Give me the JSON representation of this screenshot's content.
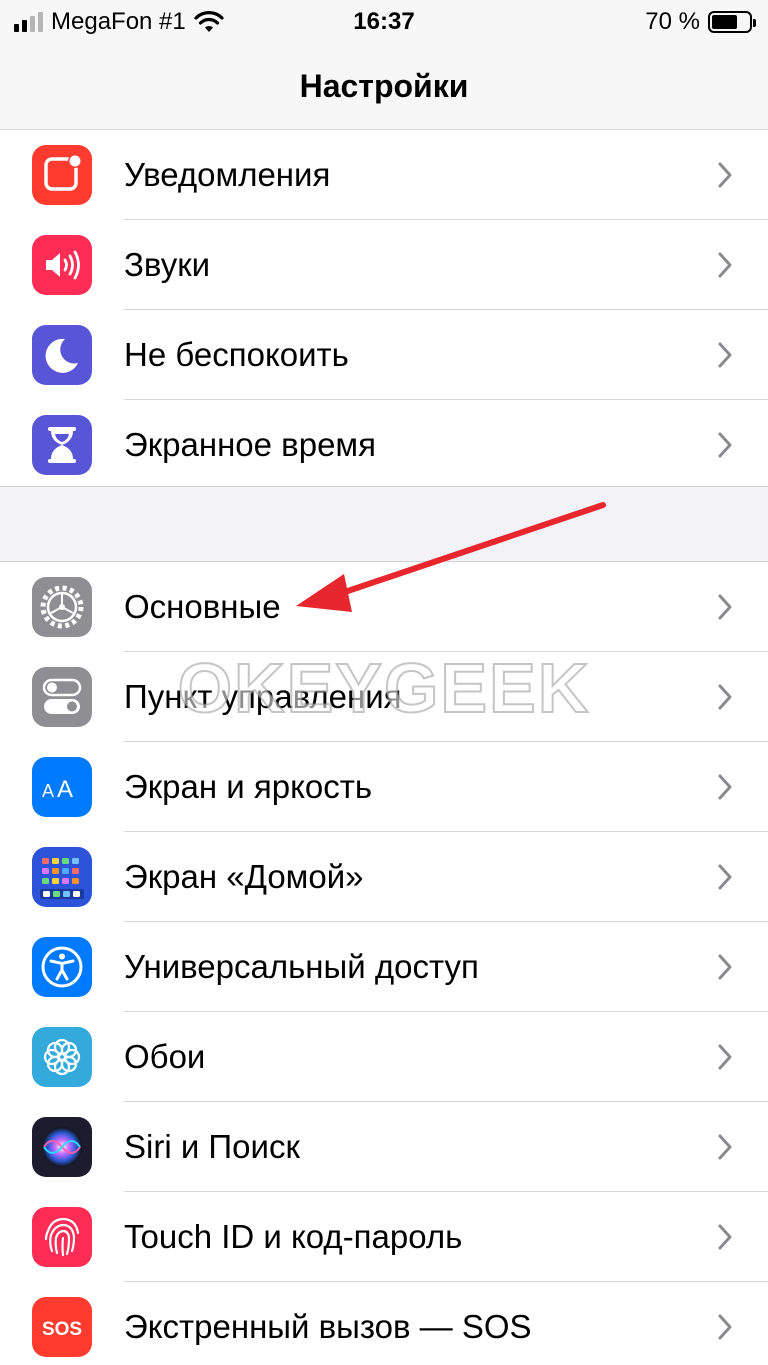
{
  "status_bar": {
    "carrier": "MegaFon #1",
    "time": "16:37",
    "battery_text": "70 %",
    "battery_level": 0.7
  },
  "nav": {
    "title": "Настройки"
  },
  "group1": [
    {
      "key": "notifications",
      "label": "Уведомления",
      "icon": "notifications-icon",
      "color": "#ff3b30"
    },
    {
      "key": "sounds",
      "label": "Звуки",
      "icon": "speaker-icon",
      "color": "#ff2d55"
    },
    {
      "key": "dnd",
      "label": "Не беспокоить",
      "icon": "moon-icon",
      "color": "#5856d6"
    },
    {
      "key": "screentime",
      "label": "Экранное время",
      "icon": "hourglass-icon",
      "color": "#5856d6"
    }
  ],
  "group2": [
    {
      "key": "general",
      "label": "Основные",
      "icon": "gear-icon",
      "color": "#8e8e93"
    },
    {
      "key": "control",
      "label": "Пункт управления",
      "icon": "toggles-icon",
      "color": "#8e8e93"
    },
    {
      "key": "display",
      "label": "Экран и яркость",
      "icon": "text-size-icon",
      "color": "#007aff"
    },
    {
      "key": "home",
      "label": "Экран «Домой»",
      "icon": "home-grid-icon",
      "color": "#2c53d8"
    },
    {
      "key": "access",
      "label": "Универсальный доступ",
      "icon": "accessibility-icon",
      "color": "#007aff"
    },
    {
      "key": "wallpaper",
      "label": "Обои",
      "icon": "flower-icon",
      "color": "#34aadc"
    },
    {
      "key": "siri",
      "label": "Siri и Поиск",
      "icon": "siri-icon",
      "color": "#1c1c2e"
    },
    {
      "key": "touchid",
      "label": "Touch ID и код-пароль",
      "icon": "fingerprint-icon",
      "color": "#ff2d55"
    },
    {
      "key": "sos",
      "label": "Экстренный вызов — SOS",
      "icon": "sos-icon",
      "color": "#ff3b30",
      "icon_text": "SOS"
    }
  ],
  "watermark": "OKEYGEEK",
  "arrow_color": "#e8262d"
}
